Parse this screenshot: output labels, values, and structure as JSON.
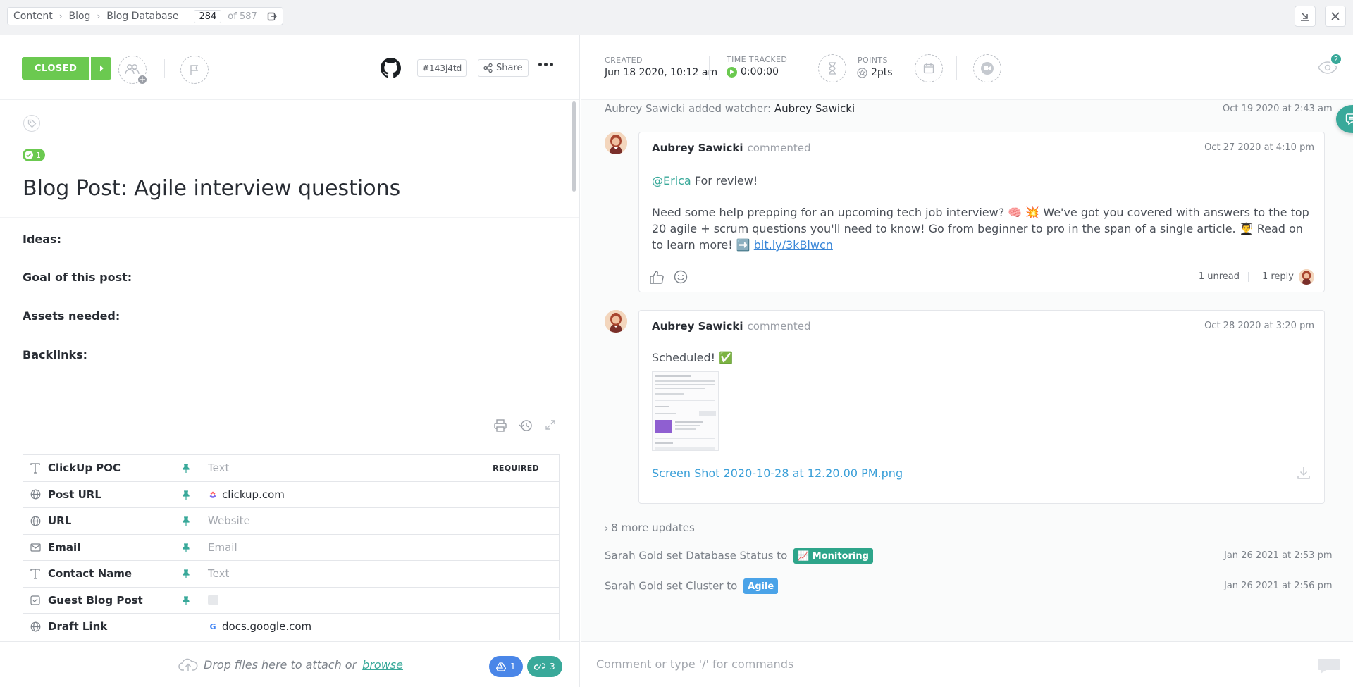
{
  "breadcrumb": {
    "items": [
      "Content",
      "Blog",
      "Blog Database"
    ],
    "current": "284",
    "total": "of 587"
  },
  "task": {
    "status": "CLOSED",
    "status_color": "#6bc950",
    "id": "#143j4td",
    "share_label": "Share",
    "subtasks_count": "1",
    "title": "Blog Post: Agile interview questions",
    "description": [
      "Ideas:",
      "Goal of this post:",
      "Assets needed:",
      "Backlinks:"
    ]
  },
  "custom_fields": [
    {
      "name": "ClickUp POC",
      "icon": "text-icon",
      "value": "Text",
      "placeholder": true,
      "required": "REQUIRED"
    },
    {
      "name": "Post URL",
      "icon": "globe-icon",
      "value": "clickup.com",
      "placeholder": false,
      "favicon": "clickup"
    },
    {
      "name": "URL",
      "icon": "globe-icon",
      "value": "Website",
      "placeholder": true
    },
    {
      "name": "Email",
      "icon": "mail-icon",
      "value": "Email",
      "placeholder": true
    },
    {
      "name": "Contact Name",
      "icon": "text-icon",
      "value": "Text",
      "placeholder": true
    },
    {
      "name": "Guest Blog Post",
      "icon": "checkbox-icon",
      "value": "",
      "checkbox": true
    },
    {
      "name": "Draft Link",
      "icon": "globe-icon",
      "value": "docs.google.com",
      "placeholder": false,
      "favicon": "google"
    }
  ],
  "attach": {
    "text": "Drop files here to attach or",
    "browse": "browse",
    "drive_count": "1",
    "links_count": "3"
  },
  "meta": {
    "created_label": "CREATED",
    "created_value": "Jun 18 2020, 10:12 am",
    "time_label": "TIME TRACKED",
    "time_value": "0:00:00",
    "points_label": "POINTS",
    "points_value": "2pts",
    "watchers": "2"
  },
  "activity": {
    "watcher_event": {
      "actor": "Aubrey Sawicki",
      "text": "added watcher:",
      "target": "Aubrey Sawicki",
      "time": "Oct 19 2020 at 2:43 am"
    },
    "comment1": {
      "author": "Aubrey Sawicki",
      "verb": "commented",
      "time": "Oct 27 2020 at 4:10 pm",
      "mention": "@Erica",
      "line1": "For review!",
      "body": "Need some help prepping for an upcoming tech job interview? 🧠 💥 We've got you covered with answers to the top 20 agile + scrum questions you'll need to know! Go from beginner to pro in the span of a single article.  👨‍🎓 Read on to learn more! ➡️",
      "link": "bit.ly/3kBlwcn",
      "unread": "1 unread",
      "replies": "1 reply"
    },
    "comment2": {
      "author": "Aubrey Sawicki",
      "verb": "commented",
      "time": "Oct 28 2020 at 3:20 pm",
      "text": "Scheduled! ✅",
      "file": "Screen Shot 2020-10-28 at 12.20.00 PM.png"
    },
    "more_updates": "8 more updates",
    "event1": {
      "text": "Sarah Gold set Database Status to",
      "badge": "📈 Monitoring",
      "badge_color": "#2ea58a",
      "time": "Jan 26 2021 at 2:53 pm"
    },
    "event2": {
      "text": "Sarah Gold set Cluster to",
      "badge": "Agile",
      "badge_color": "#4aa3e8",
      "time": "Jan 26 2021 at 2:56 pm"
    }
  },
  "comment_box": {
    "placeholder": "Comment or type '/' for commands"
  }
}
